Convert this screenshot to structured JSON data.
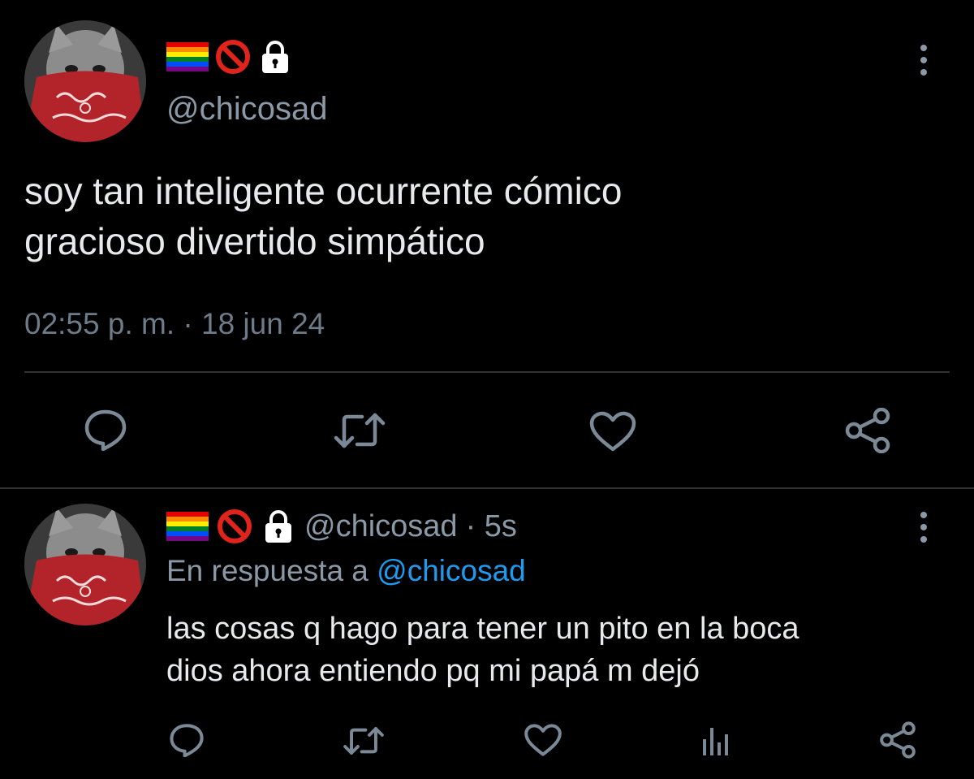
{
  "main_tweet": {
    "handle": "@chicosad",
    "text_line1": "soy tan inteligente ocurrente cómico",
    "text_line2": "gracioso divertido simpático",
    "timestamp": "02:55 p. m. · 18 jun 24"
  },
  "reply": {
    "handle": "@chicosad",
    "age": "· 5s",
    "reply_prefix": "En respuesta a",
    "reply_mention": "@chicosad",
    "text_line1": "las cosas q hago para tener un pito en la boca",
    "text_line2": "dios ahora entiendo pq mi papá m dejó"
  },
  "icons": {
    "badges": [
      "rainbow-flag-icon",
      "prohibited-icon",
      "lock-icon"
    ],
    "actions": [
      "reply-icon",
      "retweet-icon",
      "like-icon",
      "views-icon",
      "share-icon"
    ],
    "more": "more-vertical-icon"
  },
  "colors": {
    "background": "#000000",
    "text": "#e7e9ea",
    "secondary": "#8b98a5",
    "link": "#1d9bf0",
    "divider": "#2f3336"
  }
}
